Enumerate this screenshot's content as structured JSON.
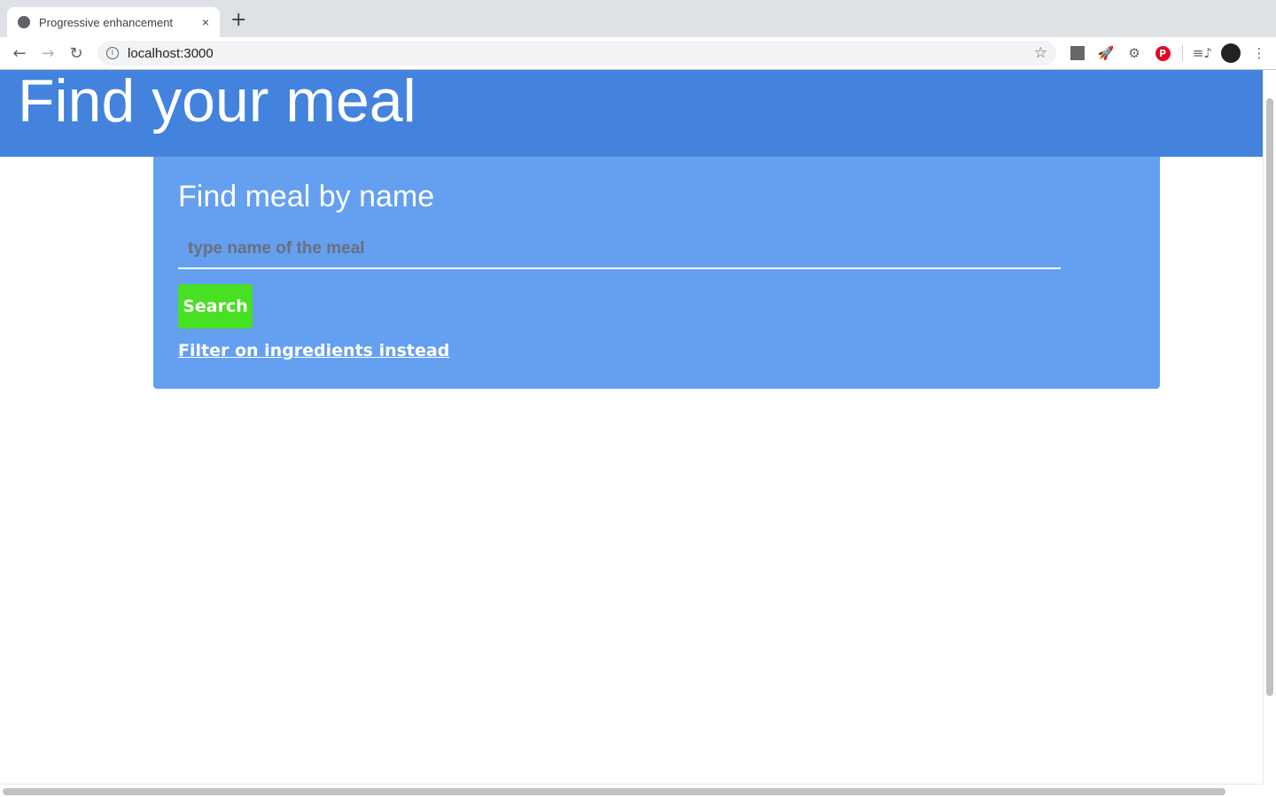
{
  "browser": {
    "tab_title": "Progressive enhancement",
    "close": "×",
    "new_tab": "+",
    "url": "localhost:3000",
    "back": "←",
    "forward": "→",
    "reload": "↻",
    "star": "☆",
    "menu": "⋮",
    "ext_rocket": "🚀",
    "ext_gear": "⚙",
    "ext_pinterest": "P",
    "ext_media": "≡♪"
  },
  "header": {
    "title": "Find your meal"
  },
  "search": {
    "heading": "Find meal by name",
    "placeholder": "type name of the meal",
    "button": "Search",
    "link": "Filter on ingredients instead"
  },
  "colors": {
    "header": "#4383dd",
    "card": "#64a0ef",
    "button": "#47e022"
  }
}
